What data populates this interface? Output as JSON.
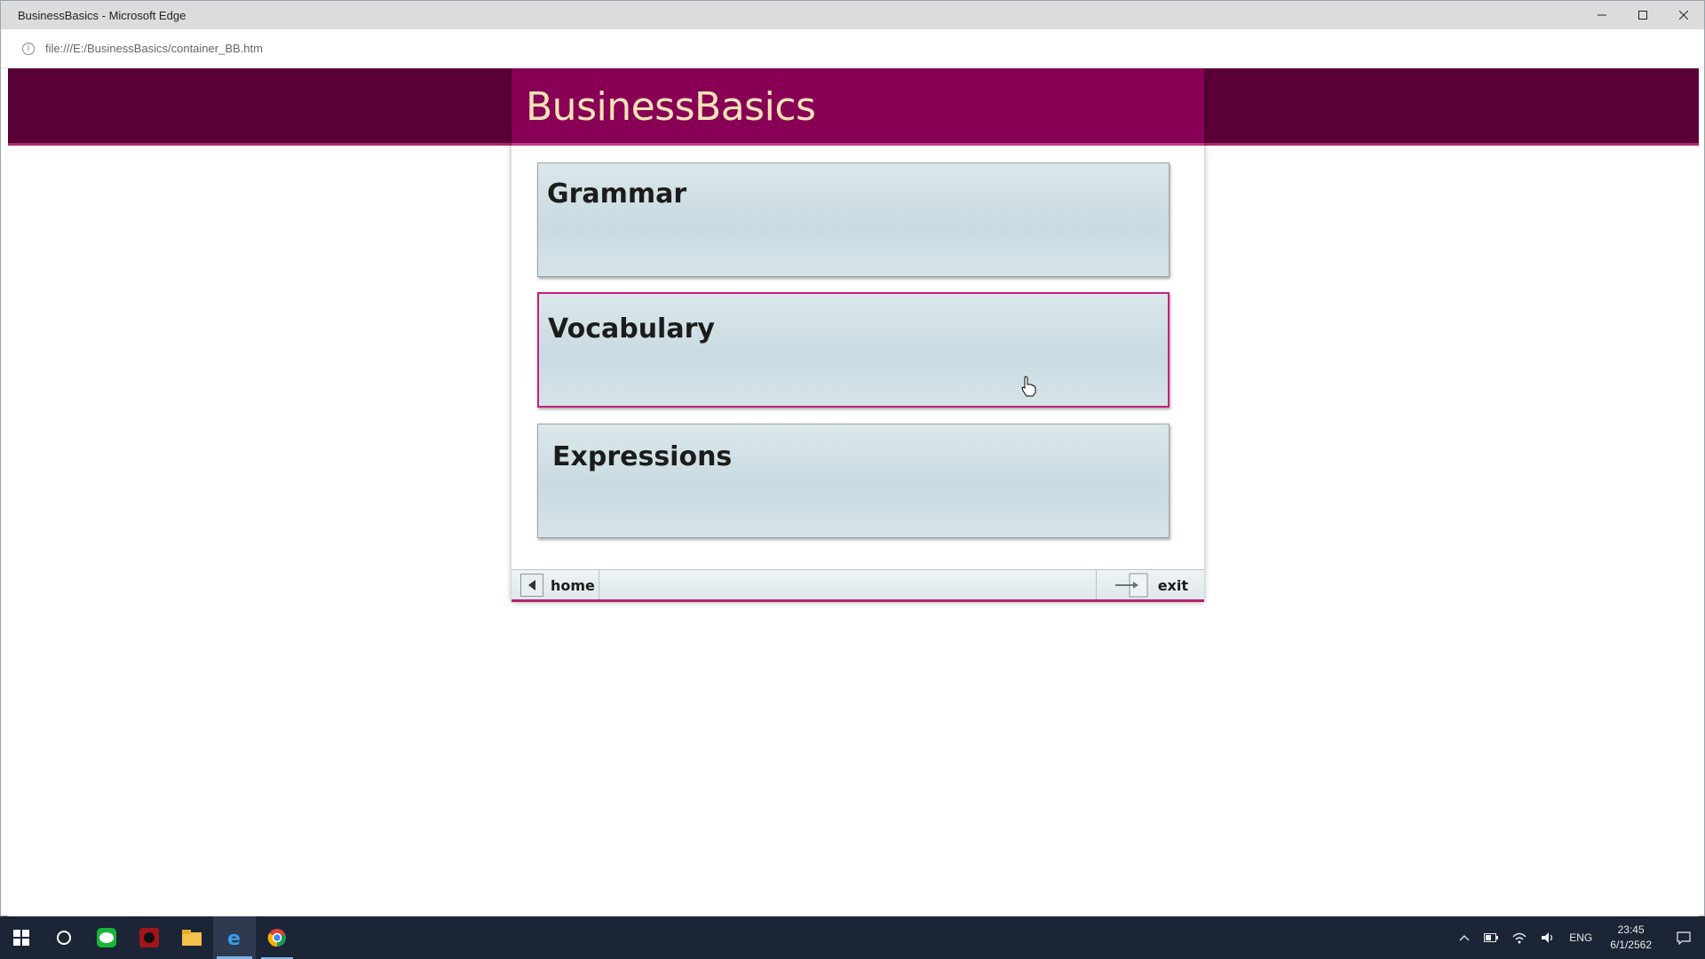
{
  "window": {
    "title": "BusinessBasics - Microsoft Edge",
    "url": "file:///E:/BusinessBasics/container_BB.htm"
  },
  "app": {
    "title": "BusinessBasics",
    "menu": [
      {
        "label": "Grammar"
      },
      {
        "label": "Vocabulary"
      },
      {
        "label": "Expressions"
      }
    ],
    "footer": {
      "home_label": "home",
      "exit_label": "exit"
    }
  },
  "taskbar": {
    "language": "ENG",
    "time": "23:45",
    "date": "6/1/2562"
  },
  "colors": {
    "header_dark": "#5a0037",
    "header_app": "#870055",
    "accent": "#c4217d",
    "title_text": "#f7e3b6",
    "button_face": "#cddfe4"
  }
}
